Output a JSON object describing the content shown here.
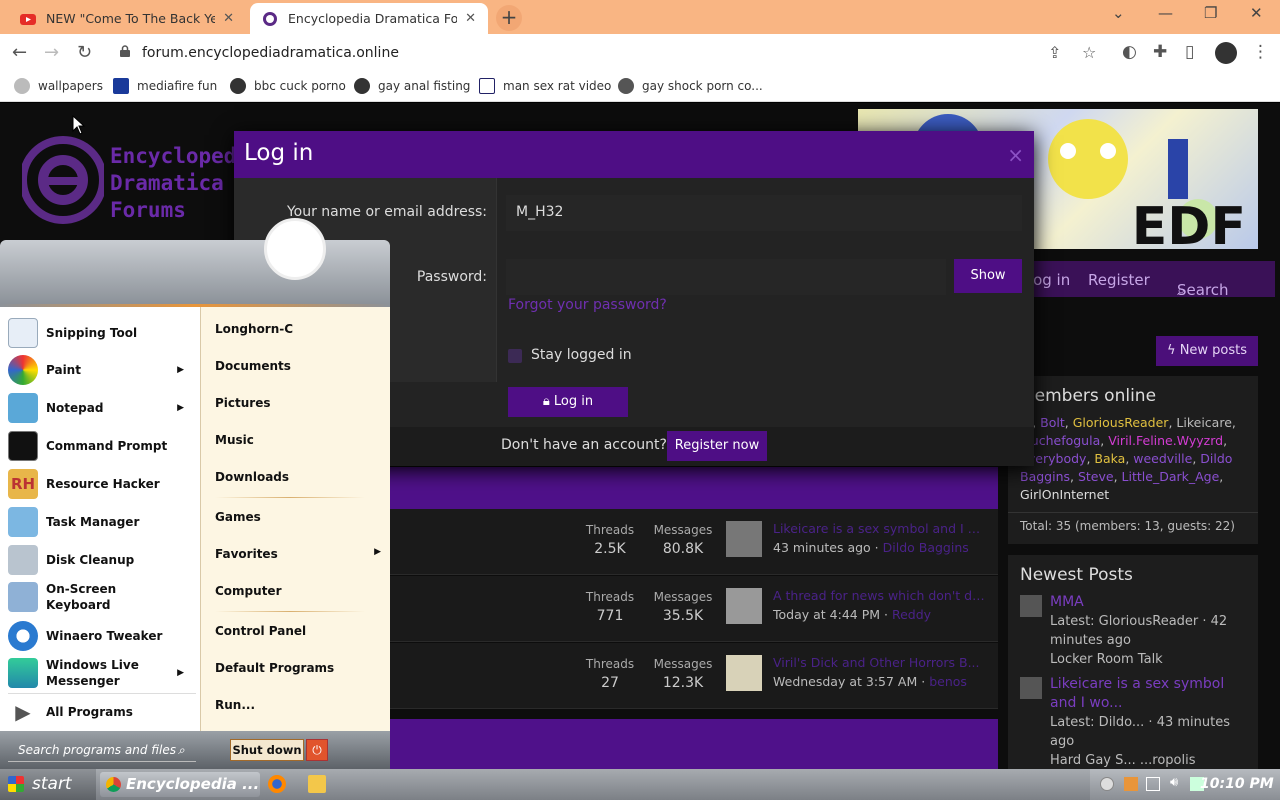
{
  "browser": {
    "tabs": [
      {
        "title": "NEW \"Come To The Back Yes\"",
        "active": false
      },
      {
        "title": "Encyclopedia Dramatica Forums",
        "active": true
      }
    ],
    "url": "forum.encyclopediadramatica.online",
    "bookmarks": [
      "wallpapers",
      "mediafire fun",
      "bbc cuck porno",
      "gay anal fisting",
      "man sex rat video",
      "gay shock porn co..."
    ]
  },
  "site": {
    "logo_lines": [
      "Encyclopedia",
      "Dramatica",
      "Forums"
    ],
    "banner_text": "EDF",
    "nav": {
      "login": "Log in",
      "register": "Register",
      "search": "Search"
    },
    "new_posts": "New posts"
  },
  "members_online": {
    "title": "Members online",
    "names": [
      {
        "name": "m",
        "color": "#8a4fd0"
      },
      {
        "name": "Bolt",
        "color": "#8a4fd0"
      },
      {
        "name": "GloriousReader",
        "color": "#e0c040"
      },
      {
        "name": "Likeicare",
        "color": "#bbbbbb"
      },
      {
        "name": "Muchefogula",
        "color": "#8a4fd0"
      },
      {
        "name": "Viril.Feline.Wyyzrd",
        "color": "#d33cd3"
      },
      {
        "name": "Everybody",
        "color": "#8a4fd0"
      },
      {
        "name": "Baka",
        "color": "#e0c040"
      },
      {
        "name": "weedville",
        "color": "#8a4fd0"
      },
      {
        "name": "Dildo Baggins",
        "color": "#8a4fd0"
      },
      {
        "name": "Steve",
        "color": "#8a4fd0"
      },
      {
        "name": "Little_Dark_Age",
        "color": "#8a4fd0"
      },
      {
        "name": "GirlOnInternet",
        "color": "#dddddd"
      }
    ],
    "total": "Total: 35 (members: 13, guests: 22)"
  },
  "newest_posts": {
    "title": "Newest Posts",
    "items": [
      {
        "title": "MMA",
        "meta": "Latest: GloriousReader · 42 minutes ago",
        "forum": "Locker Room Talk"
      },
      {
        "title": "Likeicare is a sex symbol and I wo...",
        "meta": "Latest: Dildo... · 43 minutes ago",
        "forum": "Hard Gay S... ...ropolis"
      }
    ]
  },
  "forum_nodes": [
    {
      "threads_label": "Threads",
      "threads": "2.5K",
      "messages_label": "Messages",
      "messages": "80.8K",
      "last_title": "Likeicare is a sex symbol and I w...",
      "last_time": "43 minutes ago",
      "last_user": "Dildo Baggins"
    },
    {
      "threads_label": "Threads",
      "threads": "771",
      "messages_label": "Messages",
      "messages": "35.5K",
      "last_title": "A thread for news which don't de...",
      "last_time": "Today at 4:44 PM",
      "last_user": "Reddy"
    },
    {
      "threads_label": "Threads",
      "threads": "27",
      "messages_label": "Messages",
      "messages": "12.3K",
      "last_title": "Viril's Dick and Other Horrors B...",
      "last_time": "Wednesday at 3:57 AM",
      "last_user": "benos"
    }
  ],
  "login_modal": {
    "title": "Log in",
    "close": "×",
    "name_label": "Your name or email address:",
    "name_value": "M_H32",
    "password_label": "Password:",
    "show": "Show",
    "forgot": "Forgot your password?",
    "stay_logged_in": "Stay logged in",
    "login_button": "Log in",
    "no_account": "Don't have an account?",
    "register_now": "Register now"
  },
  "start_menu": {
    "left_items": [
      "Snipping Tool",
      "Paint",
      "Notepad",
      "Command Prompt",
      "Resource Hacker",
      "Task Manager",
      "Disk Cleanup",
      "On-Screen Keyboard",
      "Winaero Tweaker",
      "Windows Live Messenger"
    ],
    "all_programs": "All Programs",
    "right_items": [
      "Longhorn-C",
      "Documents",
      "Pictures",
      "Music",
      "Downloads",
      "Games",
      "Favorites",
      "Computer",
      "Control Panel",
      "Default Programs",
      "Run..."
    ],
    "search_placeholder": "Search programs and files",
    "shutdown": "Shut down"
  },
  "taskbar": {
    "start": "start",
    "task_item": "Encyclopedia ...",
    "clock": "10:10 PM"
  }
}
